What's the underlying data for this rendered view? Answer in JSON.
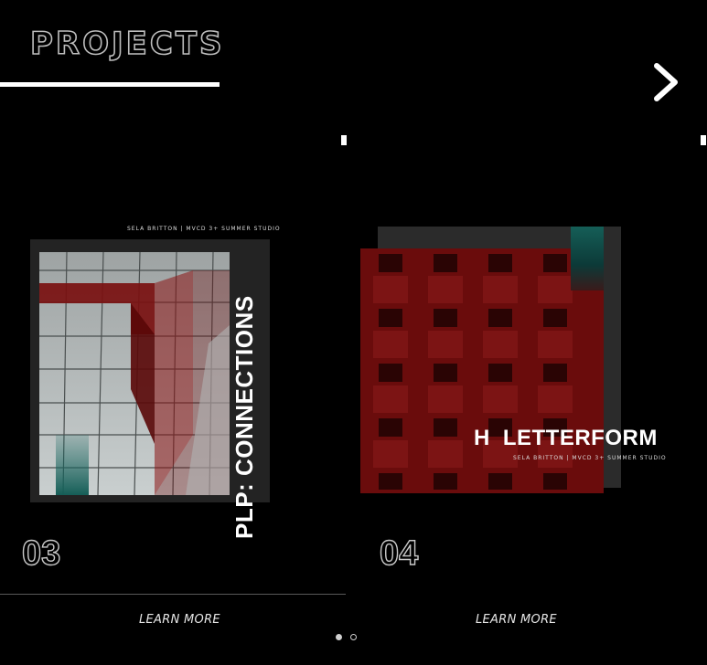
{
  "header": {
    "title": "PROJECTS",
    "next_icon": "chevron-right-icon"
  },
  "projects": [
    {
      "number": "03",
      "poster_title": "PLP: CONNECTIONS",
      "poster_credit": "SELA BRITTON | MVCD 3+ SUMMER STUDIO",
      "cta": "LEARN MORE"
    },
    {
      "number": "04",
      "poster_title_prefix": "H",
      "poster_title": "LETTERFORM",
      "poster_credit": "SELA BRITTON | MVCD 3+ SUMMER STUDIO",
      "cta": "LEARN MORE"
    }
  ],
  "carousel": {
    "dots": 2,
    "active_index": 0
  },
  "colors": {
    "background": "#000000",
    "accent_red": "#6e0a0a",
    "accent_teal": "#15605a"
  }
}
